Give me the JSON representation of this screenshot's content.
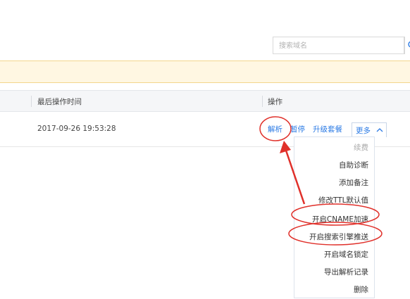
{
  "search": {
    "placeholder": "搜索域名"
  },
  "table": {
    "headers": [
      "最后操作时间",
      "操作"
    ],
    "rows": [
      {
        "last_modified": "2017-09-26 19:53:28",
        "actions": [
          "解析",
          "暂停",
          "升级套餐"
        ],
        "more_label": "更多"
      }
    ]
  },
  "more_menu": {
    "items": [
      "续费",
      "自助诊断",
      "添加备注",
      "修改TTL默认值",
      "开启CNAME加速",
      "开启搜索引擎推送",
      "开启域名锁定",
      "导出解析记录",
      "删除"
    ]
  },
  "colors": {
    "link": "#2c7be5",
    "annotation": "#e0302a",
    "notice_bg": "#fff7e2"
  }
}
